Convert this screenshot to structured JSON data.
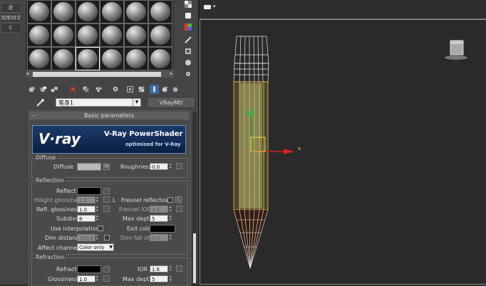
{
  "left_panel": {
    "buttons": [
      "退",
      "绘制对话",
      "C"
    ]
  },
  "material_editor": {
    "icons": {
      "get_material": "sphere-icon",
      "assign": "assign-icon",
      "reset": "close-icon"
    },
    "material_name": "笔身1",
    "material_type": "VRayMtl",
    "rollout_title": "Basic parameters",
    "vray_banner": {
      "logo": "V·ray",
      "title": "V-Ray PowerShader",
      "subtitle": "optimized for V-Ray"
    },
    "diffuse": {
      "group_title": "Diffuse",
      "diffuse_label": "Diffuse",
      "map_button": "M",
      "roughness_label": "Roughness",
      "roughness_value": "0.0"
    },
    "reflection": {
      "group_title": "Reflection",
      "reflect_label": "Reflect",
      "hilight_label": "Hilight glossiness",
      "hilight_value": "1.0",
      "l_button": "L",
      "fresnel_label": "Fresnel reflections",
      "fresnel_l": "L",
      "refl_gloss_label": "Refl. glossiness",
      "refl_gloss_value": "1.0",
      "fresnel_ior_label": "Fresnel IOR",
      "fresnel_ior_value": "1.6",
      "subdivs_label": "Subdivs",
      "subdivs_value": "8",
      "max_depth_label": "Max depth",
      "max_depth_value": "5",
      "use_interp_label": "Use interpolation",
      "exit_color_label": "Exit color",
      "dim_distance_label": "Dim distance",
      "dim_distance_value": "100.0",
      "dim_falloff_label": "Dim fall off",
      "dim_falloff_value": "0.0",
      "affect_label": "Affect channels",
      "affect_value": "Color only"
    },
    "refraction": {
      "group_title": "Refraction",
      "refract_label": "Refract",
      "ior_label": "IOR",
      "ior_value": "1.6",
      "gloss_label": "Glossiness",
      "gloss_value": "1.0",
      "max_depth_label": "Max depth",
      "max_depth_value": "5"
    }
  },
  "viewport": {
    "label": "▾",
    "axis_x": "x",
    "viewcube_icon": "viewcube-icon"
  }
}
